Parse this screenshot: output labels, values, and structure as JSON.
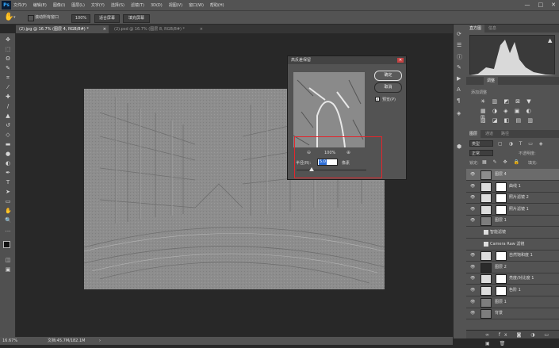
{
  "app": {
    "logo": "Ps"
  },
  "menu": [
    "文件(F)",
    "编辑(E)",
    "图像(I)",
    "图层(L)",
    "文字(Y)",
    "选择(S)",
    "滤镜(T)",
    "3D(D)",
    "视图(V)",
    "窗口(W)",
    "帮助(H)"
  ],
  "window_controls": {
    "minimize": "—",
    "maximize": "□",
    "close": "✕"
  },
  "options": {
    "scroll_all_label": "滚动所有窗口",
    "zoom_value": "100%",
    "fit_screen": "适合屏幕",
    "fill_screen": "填充屏幕"
  },
  "doc_tabs": [
    {
      "label": "(2).jpg @ 16.7% (图层 4, RGB/8#) *",
      "close": "×"
    },
    {
      "label": "(2).psd @ 16.7% (图层 8, RGB/8#) *",
      "close": "×"
    }
  ],
  "status": {
    "zoom": "16.67%",
    "doc": "文档:45.7M/182.1M"
  },
  "dialog": {
    "title": "高反差保留",
    "ok": "确定",
    "cancel": "取消",
    "preview_label": "预览(P)",
    "zoom_out": "⊖",
    "zoom_value": "100%",
    "zoom_in": "⊕",
    "radius_label": "半径(R):",
    "radius_value": "5.0",
    "radius_unit": "像素",
    "radius_slider_level": 0.22
  },
  "panels": {
    "histogram_tabs": [
      "直方图",
      "信息"
    ],
    "adjust_tabs": [
      "调整"
    ],
    "adjust_add_label": "添加调整",
    "layers_tabs": [
      "图层",
      "通道",
      "路径"
    ],
    "kind_label": "类型",
    "blend_mode": "正常",
    "opacity_label": "不透明度:",
    "lock_label": "锁定:",
    "fill_label": "填充:"
  },
  "layers": [
    {
      "name": "图层 4",
      "kind": "pixel"
    },
    {
      "name": "曲线 1",
      "kind": "adjust"
    },
    {
      "name": "照片滤镜 2",
      "kind": "adjust"
    },
    {
      "name": "照片滤镜 1",
      "kind": "adjust"
    },
    {
      "name": "图层 1",
      "kind": "smart"
    },
    {
      "name": "智能滤镜",
      "kind": "filter"
    },
    {
      "name": "Camera Raw 滤镜",
      "kind": "filter"
    },
    {
      "name": "自然饱和度 1",
      "kind": "adjust"
    },
    {
      "name": "图层 2",
      "kind": "dark"
    },
    {
      "name": "亮度/对比度 1",
      "kind": "adjust"
    },
    {
      "name": "色阶 1",
      "kind": "adjust"
    },
    {
      "name": "图层 1",
      "kind": "photo"
    },
    {
      "name": "背景",
      "kind": "photo"
    }
  ],
  "colors": {
    "accent": "#31a8ff",
    "highlight": "#e3262c",
    "canvas_gray": "#8d8d8d"
  }
}
